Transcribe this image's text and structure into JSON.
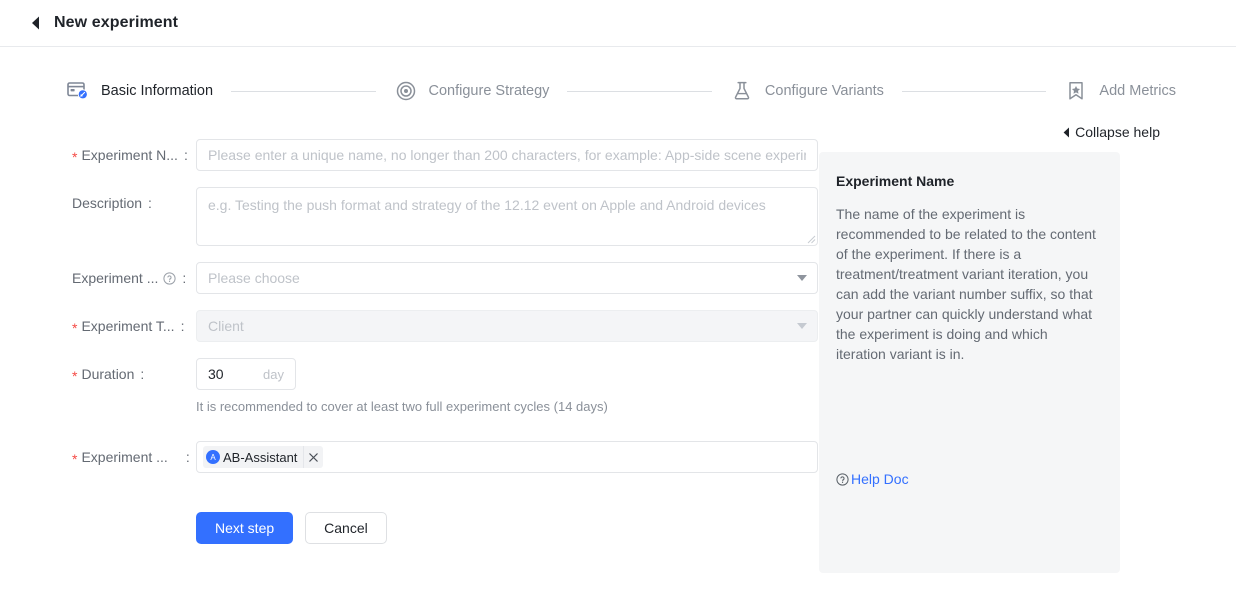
{
  "header": {
    "back_icon": "back-triangle-icon",
    "title": "New experiment"
  },
  "stepper": {
    "steps": [
      {
        "label": "Basic Information",
        "icon": "card-edit-icon",
        "state": "active"
      },
      {
        "label": "Configure Strategy",
        "icon": "target-icon",
        "state": "inactive"
      },
      {
        "label": "Configure Variants",
        "icon": "flask-icon",
        "state": "inactive"
      },
      {
        "label": "Add Metrics",
        "icon": "bookmark-star-icon",
        "state": "inactive"
      }
    ]
  },
  "form": {
    "experiment_name": {
      "label": "Experiment N...",
      "colon": ":",
      "required": true,
      "value": "",
      "placeholder": "Please enter a unique name, no longer than 200 characters, for example: App-side scene experime"
    },
    "description": {
      "label": "Description",
      "colon": ":",
      "required": false,
      "value": "",
      "placeholder": "e.g. Testing the push format and strategy of the 12.12 event on Apple and Android devices"
    },
    "experiment_type_group": {
      "label": "Experiment ...",
      "colon": ":",
      "required": false,
      "help_icon": "question-circle-icon",
      "value": "Please choose",
      "caret": "chevron-down-icon"
    },
    "experiment_terminal": {
      "label": "Experiment T...",
      "colon": ":",
      "required": true,
      "value": "Client",
      "disabled": true,
      "caret": "chevron-down-icon"
    },
    "duration": {
      "label": "Duration",
      "colon": ":",
      "required": true,
      "value": "30",
      "unit": "day",
      "hint": "It is recommended to cover at least two full experiment cycles (14 days)"
    },
    "experiment_owner": {
      "label": "Experiment ...",
      "colon": ":",
      "required": true,
      "tags": [
        {
          "avatar": "A",
          "label": "AB-Assistant",
          "close_icon": "close-icon"
        }
      ]
    }
  },
  "actions": {
    "next_label": "Next step",
    "cancel_label": "Cancel"
  },
  "help": {
    "collapse_label": "Collapse help",
    "collapse_icon": "collapse-left-triangle-icon",
    "title": "Experiment Name",
    "body": "The name of the experiment is recommended to be related to the content of the experiment. If there is a treatment/treatment variant iteration, you can add the variant number suffix, so that your partner can quickly understand what the experiment is doing and which iteration variant is in.",
    "doc_link_label": "Help Doc",
    "doc_link_icon": "question-circle-icon"
  },
  "colors": {
    "primary": "#3370ff",
    "required_star": "#f54a45",
    "panel_bg": "#f5f6f7",
    "text": "#1f2329",
    "muted": "#646a73",
    "placeholder": "#bfc3c9"
  }
}
